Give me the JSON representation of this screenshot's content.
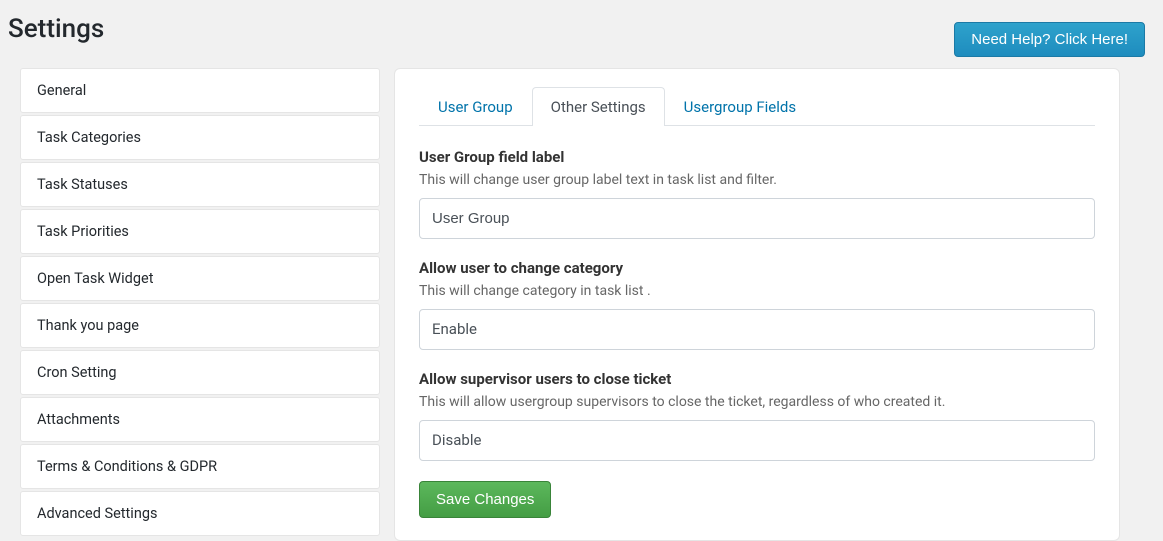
{
  "page": {
    "title": "Settings",
    "help_button": "Need Help? Click Here!"
  },
  "sidebar": {
    "items": [
      "General",
      "Task Categories",
      "Task Statuses",
      "Task Priorities",
      "Open Task Widget",
      "Thank you page",
      "Cron Setting",
      "Attachments",
      "Terms & Conditions & GDPR",
      "Advanced Settings"
    ]
  },
  "main": {
    "tabs": [
      {
        "label": "User Group",
        "active": false
      },
      {
        "label": "Other Settings",
        "active": true
      },
      {
        "label": "Usergroup Fields",
        "active": false
      }
    ],
    "fields": {
      "user_group_label": {
        "label": "User Group field label",
        "desc": "This will change user group label text in task list and filter.",
        "value": "User Group"
      },
      "allow_change_category": {
        "label": "Allow user to change category",
        "desc": "This will change category in task list .",
        "value": "Enable"
      },
      "allow_supervisor_close": {
        "label": "Allow supervisor users to close ticket",
        "desc": "This will allow usergroup supervisors to close the ticket, regardless of who created it.",
        "value": "Disable"
      }
    },
    "save_button": "Save Changes"
  }
}
